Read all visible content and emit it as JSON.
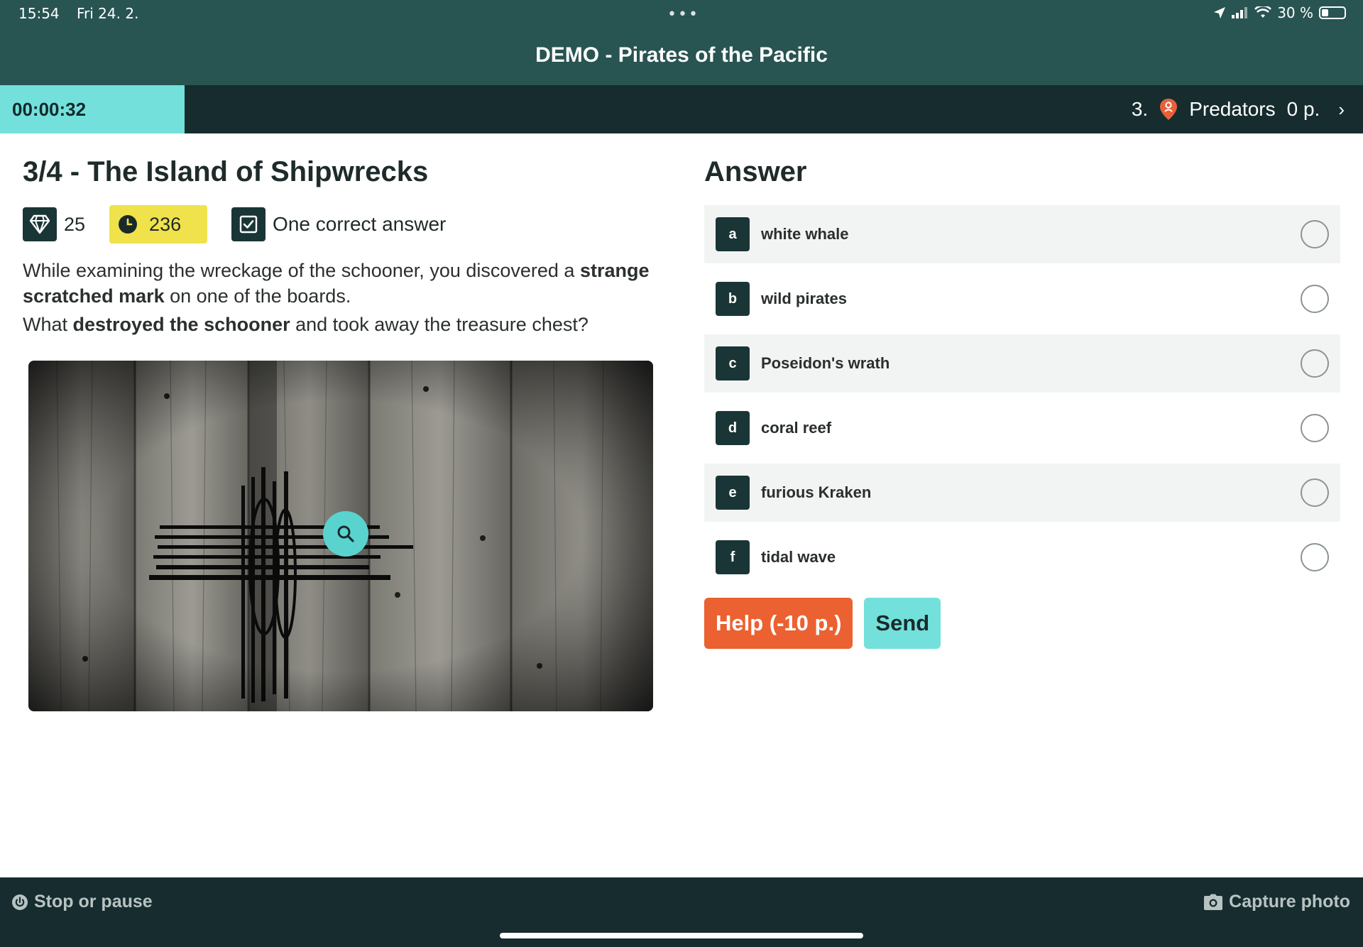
{
  "status_bar": {
    "time": "15:54",
    "date": "Fri 24. 2.",
    "battery": "30 %"
  },
  "header": {
    "title": "DEMO - Pirates of the Pacific"
  },
  "timer_bar": {
    "elapsed": "00:00:32",
    "rank": "3.",
    "team_name": "Predators",
    "points": "0 p."
  },
  "task": {
    "title": "3/4 - The Island of Shipwrecks",
    "points": "25",
    "time_limit": "236",
    "answer_type": "One correct answer",
    "description": {
      "line1_a": "While examining the wreckage of the schooner, you discovered a ",
      "line1_bold": "strange scratched mark",
      "line1_b": " on one of the boards.",
      "line2_a": "What ",
      "line2_bold": "destroyed the schooner",
      "line2_b": " and took away the treasure chest?"
    }
  },
  "answer": {
    "title": "Answer",
    "options": [
      {
        "letter": "a",
        "label": "white whale"
      },
      {
        "letter": "b",
        "label": "wild pirates"
      },
      {
        "letter": "c",
        "label": "Poseidon's wrath"
      },
      {
        "letter": "d",
        "label": "coral reef"
      },
      {
        "letter": "e",
        "label": "furious Kraken"
      },
      {
        "letter": "f",
        "label": "tidal wave"
      }
    ],
    "help_label": "Help (-10 p.)",
    "send_label": "Send"
  },
  "footer": {
    "stop_label": "Stop or pause",
    "capture_label": "Capture photo"
  },
  "colors": {
    "header_bg": "#285452",
    "dark_bar": "#162c2e",
    "accent_teal": "#73e0dc",
    "help_orange": "#eb6131",
    "time_yellow": "#efe24b",
    "pin_orange": "#e8603a"
  }
}
